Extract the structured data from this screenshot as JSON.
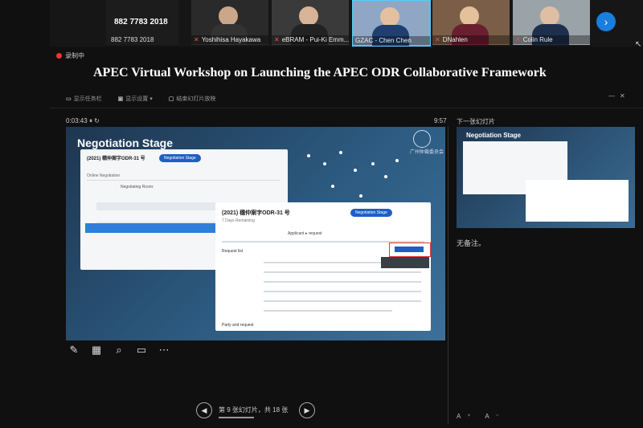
{
  "participants": [
    {
      "label": "882 7783 2018",
      "kind": "phone"
    },
    {
      "label": "Yoshihisa Hayakawa",
      "muted": true
    },
    {
      "label": "eBRAM - Pui-Ki Emm...",
      "muted": true
    },
    {
      "label": "GZAC - Chen Chen",
      "muted": false
    },
    {
      "label": "DNahlen",
      "muted": true
    },
    {
      "label": "Colin Rule",
      "muted": true
    }
  ],
  "phone_number_display": "882 7783 2018",
  "recording_label": "录制中",
  "meeting_title": "APEC Virtual Workshop on Launching the APEC ODR Collaborative Framework",
  "toolbar": [
    "显示任务栏",
    "显示设置",
    "结束幻灯片放映"
  ],
  "elapsed_time": "0:03:43",
  "clock": "9:57",
  "next_slide_label": "下一张幻灯片",
  "slide": {
    "title": "Negotiation Stage",
    "logo_text": "广州仲裁委员会",
    "card1": {
      "case_no": "(2021) 穗仲案字ODR-31 号",
      "button": "Negotiation Stage",
      "tab": "Online Negotiation",
      "room": "Negotiating Room:"
    },
    "card2": {
      "case_no": "(2021) 穗仲案字ODR-31 号",
      "button": "Negotiation Stage",
      "sub": "7 Days Remaining",
      "tabs": "Applicant  ▸ request",
      "request_list": "Request list",
      "parties": "Party and request"
    }
  },
  "thumbnail": {
    "title": "Negotiation Stage"
  },
  "notes_text": "无备注。",
  "slide_counter": "第 9 张幻灯片，共 18 张",
  "font_buttons": "A⁺ A⁻",
  "colors": {
    "accent": "#1a7de0",
    "record": "#e33333",
    "slide_blue": "#2c5a80"
  }
}
